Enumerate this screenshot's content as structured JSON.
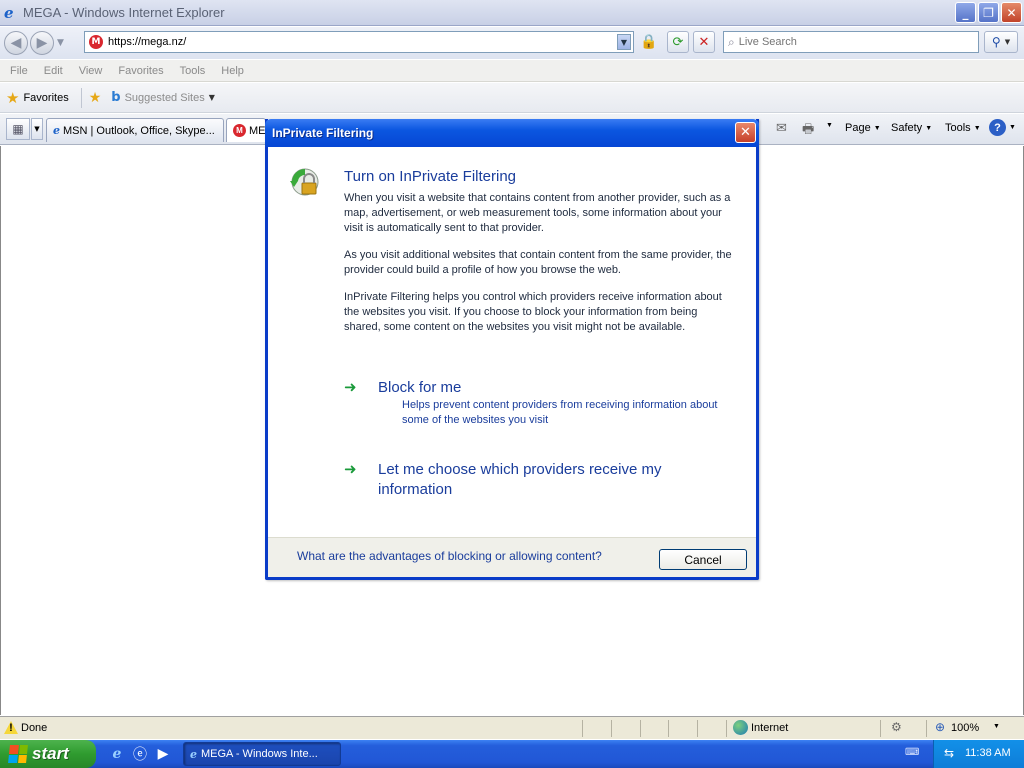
{
  "window": {
    "title": "MEGA - Windows Internet Explorer",
    "min": "_",
    "max": "❐",
    "close": "✕"
  },
  "address": {
    "url": "https://mega.nz/",
    "search_placeholder": "Live Search"
  },
  "menu": [
    "File",
    "Edit",
    "View",
    "Favorites",
    "Tools",
    "Help"
  ],
  "favorites": {
    "label": "Favorites",
    "suggested": "Suggested Sites"
  },
  "tabs": [
    {
      "label": "MSN | Outlook, Office, Skype..."
    },
    {
      "label": "MEG"
    }
  ],
  "command": {
    "page": "Page",
    "safety": "Safety",
    "tools": "Tools",
    "help": "?"
  },
  "dialog": {
    "title": "InPrivate Filtering",
    "heading": "Turn on InPrivate Filtering",
    "para1": "When you visit a website that contains content from another provider, such as a map, advertisement, or web measurement tools, some information about your visit is automatically sent to that provider.",
    "para2": "As you visit additional websites that contain content from the same provider, the provider could build a profile of how you browse the web.",
    "para3": "InPrivate Filtering helps you control which providers receive information about the websites you visit.  If you choose to block your information from being shared, some content on the websites you visit might not be available.",
    "option1_label": "Block for me",
    "option1_desc": "Helps prevent content providers from receiving information about some of the websites you visit",
    "option2_label": "Let me choose which providers receive my information",
    "link": "What are the advantages of blocking or allowing content?",
    "cancel": "Cancel"
  },
  "status": {
    "text": "Done",
    "zone": "Internet",
    "zoom": "100%"
  },
  "taskbar": {
    "start": "start",
    "task": "MEGA - Windows Inte...",
    "clock": "11:38 AM"
  }
}
